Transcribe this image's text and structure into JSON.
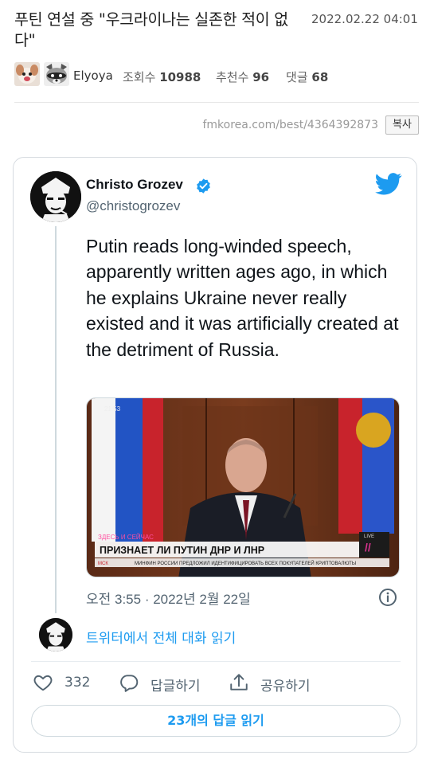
{
  "post": {
    "title": "푸틴 연설 중 \"우크라이나는 실존한 적이 없다\"",
    "date": "2022.02.22 04:01",
    "author": "Elyoya",
    "views_label": "조회수",
    "views": "10988",
    "likes_label": "추천수",
    "likes": "96",
    "comments_label": "댓글",
    "comments": "68"
  },
  "url_bar": {
    "url": "fmkorea.com/best/4364392873",
    "copy_label": "복사"
  },
  "tweet": {
    "display_name": "Christo Grozev",
    "handle": "@christogrozev",
    "text": "Putin reads long-winded speech, apparently written ages ago, in which he explains Ukraine never really existed and it was artificially created at the detriment of Russia.",
    "media": {
      "timestamp": "21:53",
      "channel_tag": "ЗДЕСЬ И СЕЙЧАС",
      "headline": "ПРИЗНАЕТ ЛИ ПУТИН ДНР И ЛНР",
      "ticker_city": "МСК",
      "ticker_text": "МИНФИН РОССИИ ПРЕДЛОЖИЛ ИДЕНТИФИЦИРОВАТЬ ВСЕХ ПОКУПАТЕЛЕЙ КРИПТОВАЛЮТЫ",
      "live_label": "LIVE"
    },
    "time": "오전 3:55 · 2022년 2월 22일",
    "read_conversation": "트위터에서 전체 대화 읽기",
    "like_count": "332",
    "reply_label": "답글하기",
    "share_label": "공유하기",
    "read_replies": "23개의 답글 읽기"
  },
  "colors": {
    "twitter_blue": "#1d9bf0",
    "text_primary": "#0f1419",
    "text_secondary": "#536471",
    "border": "#cfd9de"
  },
  "icons": {
    "verified": "verified-badge-icon",
    "bird": "twitter-bird-icon",
    "info": "info-icon",
    "like": "heart-icon",
    "reply": "speech-bubble-icon",
    "share": "share-upload-icon"
  }
}
